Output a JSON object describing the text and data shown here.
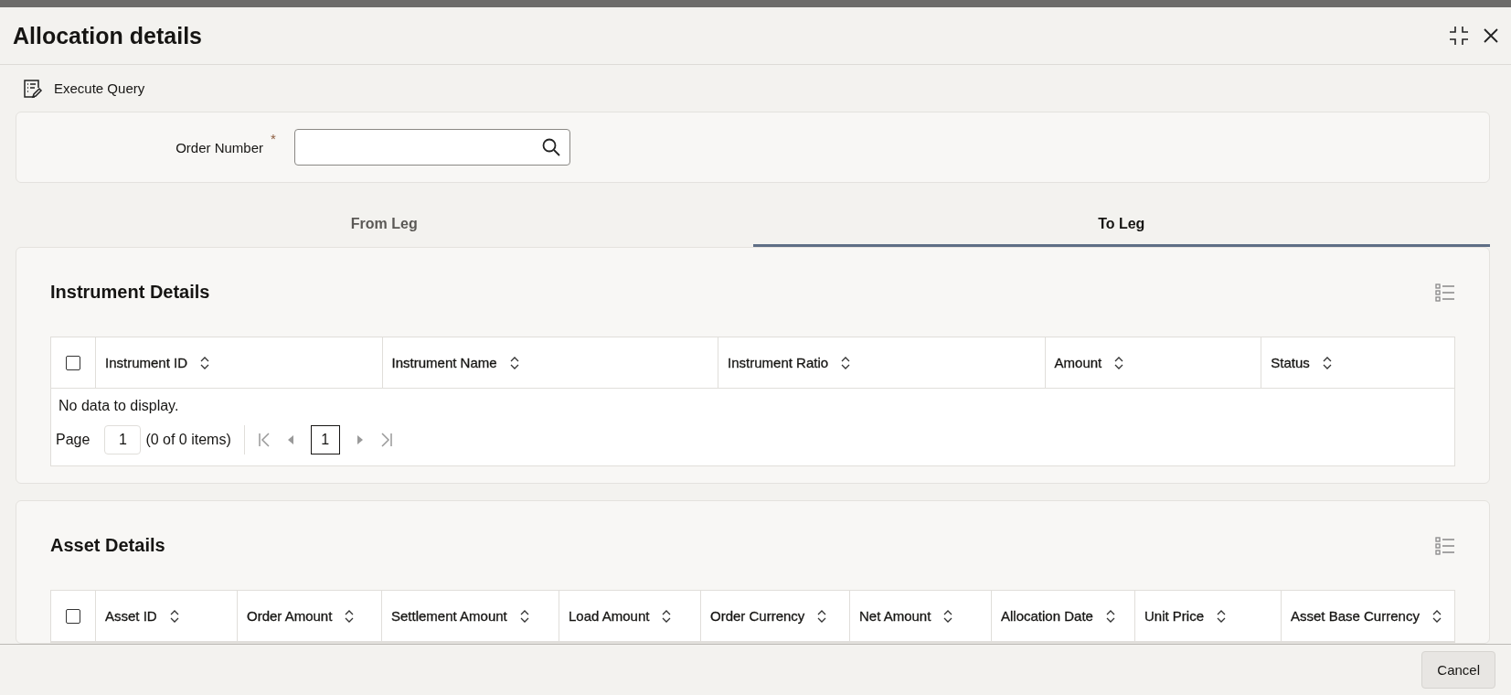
{
  "window": {
    "title": "Allocation details"
  },
  "toolbar": {
    "execute_query": "Execute Query"
  },
  "query": {
    "label": "Order Number",
    "required_mark": "*"
  },
  "tabs": [
    {
      "label": "From Leg",
      "selected": false
    },
    {
      "label": "To Leg",
      "selected": true
    }
  ],
  "instrument_details": {
    "title": "Instrument Details",
    "select_all_checked": false,
    "columns": [
      "Instrument ID",
      "Instrument Name",
      "Instrument Ratio",
      "Amount",
      "Status"
    ],
    "empty_message": "No data to display.",
    "pagination": {
      "page_label": "Page",
      "page_value": "1",
      "summary": "(0 of 0 items)",
      "current_page": "1"
    }
  },
  "asset_details": {
    "title": "Asset Details",
    "select_all_checked": false,
    "columns": [
      "Asset ID",
      "Order Amount",
      "Settlement Amount",
      "Load Amount",
      "Order Currency",
      "Net Amount",
      "Allocation Date",
      "Unit Price",
      "Asset Base Currency"
    ]
  },
  "footer": {
    "buttons": [
      "Cancel"
    ]
  }
}
